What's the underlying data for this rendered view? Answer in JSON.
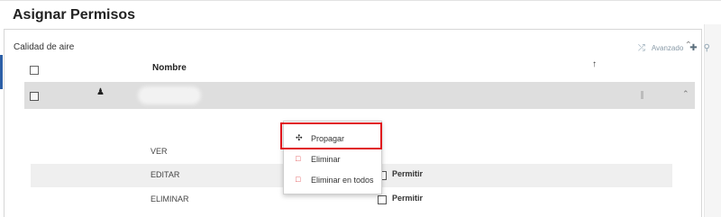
{
  "page": {
    "title": "Asignar Permisos"
  },
  "panel": {
    "title": "Calidad de aire"
  },
  "toolbar": {
    "advanced_label": "Avanzado"
  },
  "table": {
    "header": {
      "name_label": "Nombre"
    }
  },
  "permissions": [
    {
      "name": "VER",
      "checkbox_label": ""
    },
    {
      "name": "EDITAR",
      "checkbox_label": "Permitir"
    },
    {
      "name": "ELIMINAR",
      "checkbox_label": "Permitir"
    }
  ],
  "context_menu": {
    "items": [
      {
        "label": "Propagar",
        "icon": "arrows-expand-icon"
      },
      {
        "label": "Eliminar",
        "icon": "trash-icon"
      },
      {
        "label": "Eliminar en todos",
        "icon": "trash-icon"
      }
    ]
  },
  "colors": {
    "highlight": "#e0161d",
    "delete_icon": "#e0464a",
    "selected_row": "#dedede"
  }
}
